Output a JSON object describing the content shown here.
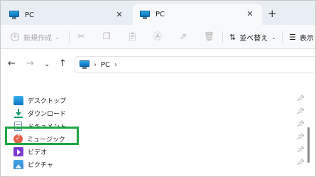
{
  "tabs": [
    {
      "label": "PC",
      "icon": "pc-icon",
      "active": false
    },
    {
      "label": "PC",
      "icon": "pc-icon",
      "active": true
    }
  ],
  "tab_close_glyph": "✕",
  "new_tab_glyph": "+",
  "toolbar": {
    "new_label": "新規作成",
    "sort_label": "並べ替え",
    "view_label": "表示",
    "caret": "⌄",
    "icons": [
      "cut-icon",
      "copy-icon",
      "paste-icon",
      "rename-icon",
      "share-icon",
      "delete-icon"
    ]
  },
  "address": {
    "back": "←",
    "forward": "→",
    "recent": "⌄",
    "up": "↑",
    "breadcrumb": "PC",
    "chevron": "›"
  },
  "nav": {
    "items": [
      {
        "label": "デスクトップ",
        "icon": "desktop-icon"
      },
      {
        "label": "ダウンロード",
        "icon": "download-icon"
      },
      {
        "label": "ドキュメント",
        "icon": "documents-icon"
      },
      {
        "label": "ミュージック",
        "icon": "music-icon"
      },
      {
        "label": "ビデオ",
        "icon": "video-icon"
      },
      {
        "label": "ピクチャ",
        "icon": "pictures-icon"
      }
    ],
    "pin_glyph": "📌",
    "highlight_color": "#1fa645"
  }
}
